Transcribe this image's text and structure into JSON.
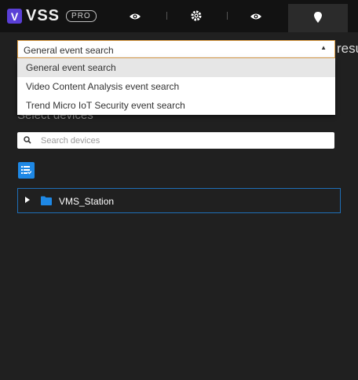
{
  "app": {
    "logo_letter": "V",
    "logo_text": "VSS",
    "logo_badge": "PRO"
  },
  "tabs": [
    {
      "icon": "eye-icon"
    },
    {
      "icon": "gear-icon"
    },
    {
      "icon": "eye-icon"
    },
    {
      "icon": "map-pin-icon",
      "active": true
    }
  ],
  "event_search": {
    "selected": "General event search",
    "options": [
      "General event search",
      "Video Content Analysis event search",
      "Trend Micro IoT Security event search"
    ],
    "overflow_text": "resu"
  },
  "devices": {
    "label": "Select devices",
    "search_placeholder": "Search devices",
    "tree": [
      {
        "label": "VMS_Station",
        "icon": "folder-icon",
        "expanded": false
      }
    ]
  },
  "colors": {
    "accent": "#1e88e5",
    "dropdown_border": "#e5a44a",
    "logo": "#5a3fd6"
  }
}
